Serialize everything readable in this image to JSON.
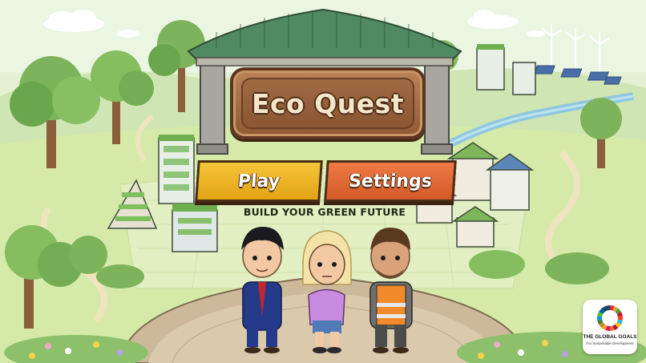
{
  "game": {
    "title": "Eco Quest",
    "tagline": "BUILD YOUR GREEN FUTURE"
  },
  "menu": {
    "play_label": "Play",
    "settings_label": "Settings"
  },
  "badge": {
    "title": "THE GLOBAL GOALS",
    "subtitle": "For Sustainable Development"
  },
  "characters": [
    {
      "outfit": "blue-suit",
      "hair": "black"
    },
    {
      "outfit": "purple-shirt",
      "hair": "blonde"
    },
    {
      "outfit": "orange-safety-vest",
      "hair": "brown"
    }
  ],
  "colors": {
    "play_button": "#f1b82c",
    "settings_button": "#e36a35",
    "sign_wood": "#9c6640",
    "roof_green": "#4f8a63",
    "grass": "#cfe6a3",
    "sky": "#e9f5dc"
  }
}
